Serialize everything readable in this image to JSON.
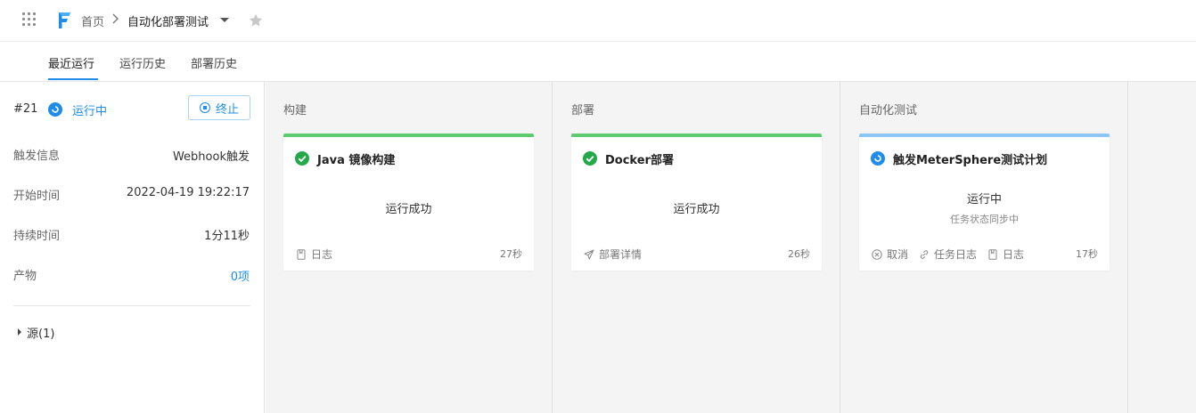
{
  "header": {
    "home": "首页",
    "current": "自动化部署测试"
  },
  "tabs": [
    {
      "label": "最近运行"
    },
    {
      "label": "运行历史"
    },
    {
      "label": "部署历史"
    }
  ],
  "run": {
    "number": "#21",
    "status": "运行中",
    "stop_label": "终止",
    "fields": [
      {
        "label": "触发信息",
        "value": "Webhook触发"
      },
      {
        "label": "开始时间",
        "value": "2022-04-19 19:22:17"
      },
      {
        "label": "持续时间",
        "value": "1分11秒"
      },
      {
        "label": "产物",
        "value": "0项"
      }
    ],
    "source_label": "源(1)"
  },
  "stages": [
    {
      "title": "构建",
      "card": {
        "name": "Java 镜像构建",
        "status": "运行成功",
        "actions": [
          "日志"
        ],
        "duration": "27秒"
      }
    },
    {
      "title": "部署",
      "card": {
        "name": "Docker部署",
        "status": "运行成功",
        "actions": [
          "部署详情"
        ],
        "duration": "26秒"
      }
    },
    {
      "title": "自动化测试",
      "card": {
        "name": "触发MeterSphere测试计划",
        "status": "运行中",
        "sub": "任务状态同步中",
        "actions": [
          "取消",
          "任务日志",
          "日志"
        ],
        "duration": "17秒"
      }
    }
  ],
  "colors": {
    "accent": "#1e8ce8",
    "success": "#23a94a",
    "success_bar": "#5fcb71",
    "running_bar": "#8cc6f5"
  }
}
